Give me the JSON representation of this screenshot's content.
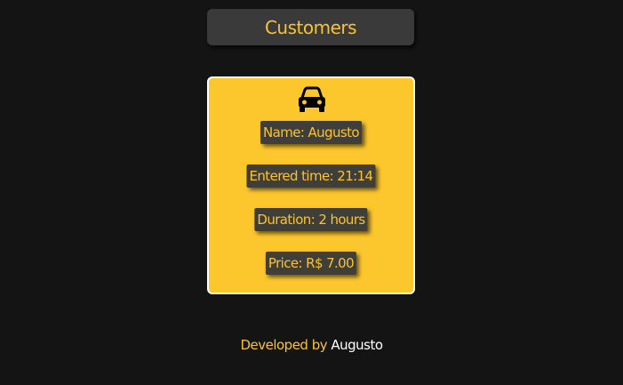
{
  "header": {
    "title": "Customers"
  },
  "customer_card": {
    "icon": "car-icon",
    "name": "Name: Augusto",
    "entered_time": "Entered time: 21:14",
    "duration": "Duration: 2 hours",
    "price": "Price: R$ 7.00"
  },
  "footer": {
    "prefix": "Developed by",
    "author": "Augusto"
  },
  "colors": {
    "background": "#141414",
    "accent": "#fcc62d",
    "panel": "#3a3a3a",
    "label_bg": "#403e39"
  }
}
